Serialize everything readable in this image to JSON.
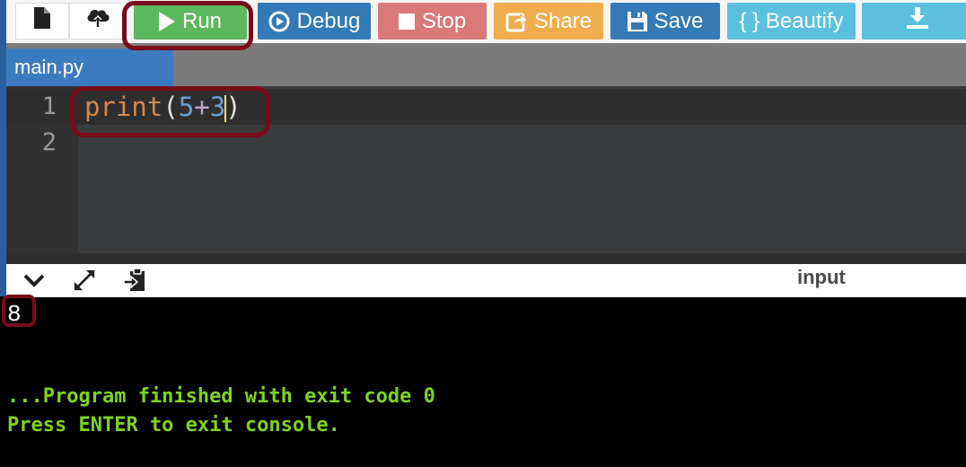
{
  "toolbar": {
    "run_label": "Run",
    "debug_label": "Debug",
    "stop_label": "Stop",
    "share_label": "Share",
    "save_label": "Save",
    "beautify_label": "{ } Beautify",
    "icons": [
      "new-file-icon",
      "upload-icon",
      "play-icon",
      "debug-icon",
      "stop-icon",
      "share-icon",
      "save-icon",
      "download-icon"
    ],
    "colors": {
      "run": "#5cb85c",
      "debug": "#337ab7",
      "stop": "#d9797a",
      "share": "#f0ad4e",
      "save": "#337ab7",
      "beautify": "#5bc0de",
      "download": "#5bc0de"
    }
  },
  "tab": {
    "label": "main.py"
  },
  "editor": {
    "lines": [
      {
        "number": "1",
        "tokens": [
          "print",
          "(",
          "5",
          "+",
          "3",
          ")"
        ]
      },
      {
        "number": "2",
        "tokens": []
      }
    ]
  },
  "console_toolbar": {
    "icons": [
      "chevron-down-icon",
      "expand-icon",
      "clipboard-icon"
    ],
    "input_label": "input"
  },
  "console": {
    "output_value": "8",
    "finish_message": "...Program finished with exit code 0",
    "press_message": "Press ENTER to exit console.",
    "text_color": "#7ed321"
  },
  "highlight_color": "#7a0b1c"
}
